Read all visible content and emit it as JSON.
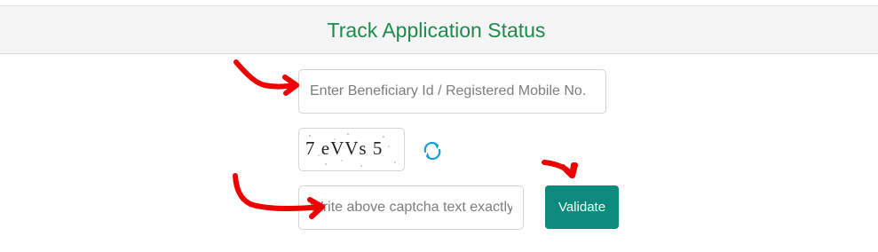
{
  "header": {
    "title": "Track Application Status"
  },
  "form": {
    "beneficiary_placeholder": "Enter Beneficiary Id / Registered Mobile No.",
    "beneficiary_value": "",
    "captcha_image_text": "7 eVVs 5",
    "captcha_input_placeholder": "Write above captcha text exactly",
    "captcha_input_value": "",
    "validate_label": "Validate"
  },
  "icons": {
    "refresh": "refresh-icon"
  },
  "colors": {
    "title": "#1e8a4c",
    "validate_button": "#0c8a7e",
    "refresh_icon": "#1a9fd1",
    "annotation_arrows": "#ee0000"
  }
}
